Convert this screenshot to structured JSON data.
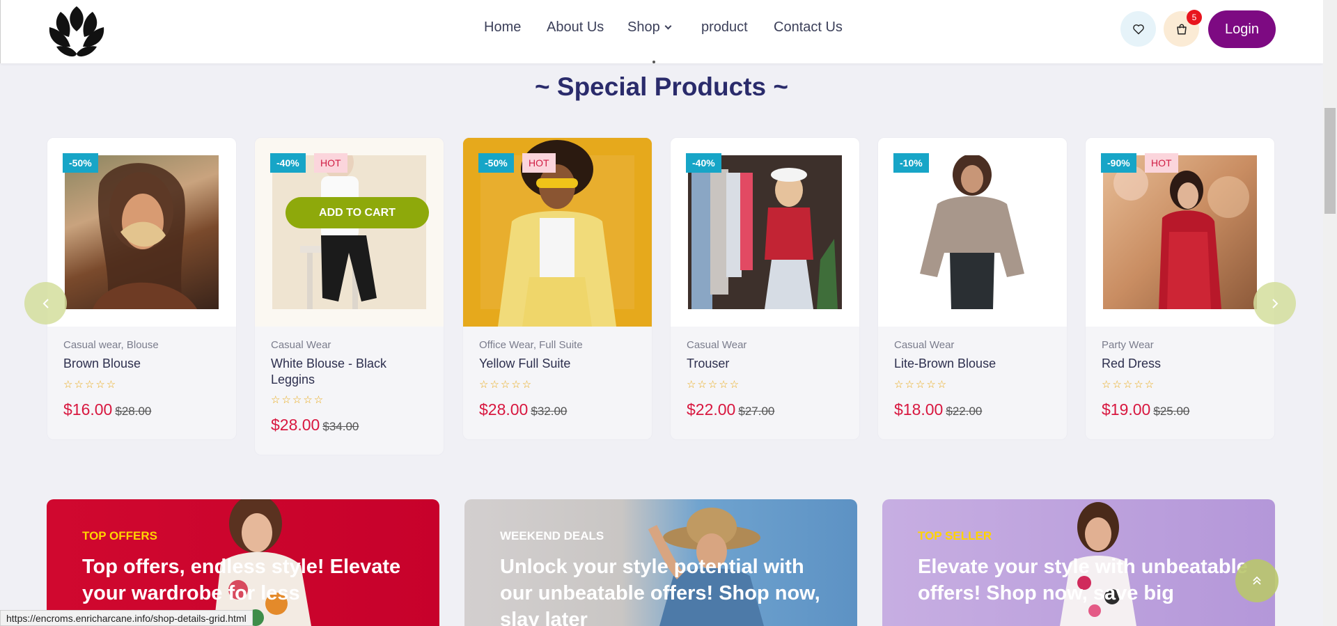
{
  "header": {
    "logo_icon": "leaf-lotus-logo",
    "nav": [
      {
        "label": "Home"
      },
      {
        "label": "About Us"
      },
      {
        "label": "Shop"
      },
      {
        "label": "product"
      },
      {
        "label": "Contact Us"
      }
    ],
    "wishlist_icon": "heart-icon",
    "cart_icon": "shopping-bag-icon",
    "cart_count": "5",
    "login_label": "Login"
  },
  "section": {
    "title": "~ Special Products ~"
  },
  "products": [
    {
      "discount": "-50%",
      "hot": "",
      "category": "Casual wear, Blouse",
      "name": "Brown Blouse",
      "rating": 0,
      "price": "$16.00",
      "old_price": "$28.00"
    },
    {
      "discount": "-40%",
      "hot": "HOT",
      "category": "Casual Wear",
      "name": "White Blouse - Black Leggins",
      "rating": 0,
      "price": "$28.00",
      "old_price": "$34.00",
      "add_to_cart": "ADD TO CART"
    },
    {
      "discount": "-50%",
      "hot": "HOT",
      "category": "Office Wear, Full Suite",
      "name": "Yellow Full Suite",
      "rating": 0,
      "price": "$28.00",
      "old_price": "$32.00"
    },
    {
      "discount": "-40%",
      "hot": "",
      "category": "Casual Wear",
      "name": "Trouser",
      "rating": 0,
      "price": "$22.00",
      "old_price": "$27.00"
    },
    {
      "discount": "-10%",
      "hot": "",
      "category": "Casual Wear",
      "name": "Lite-Brown Blouse",
      "rating": 0,
      "price": "$18.00",
      "old_price": "$22.00"
    },
    {
      "discount": "-90%",
      "hot": "HOT",
      "category": "Party Wear",
      "name": "Red Dress",
      "rating": 0,
      "price": "$19.00",
      "old_price": "$25.00"
    }
  ],
  "stars_text": "☆☆☆☆☆",
  "carousel": {
    "prev_icon": "chevron-left-icon",
    "next_icon": "chevron-right-icon"
  },
  "promos": [
    {
      "tag": "TOP OFFERS",
      "text": "Top offers, endless style! Elevate your wardrobe for less",
      "tag_color": "#ffd400"
    },
    {
      "tag": "WEEKEND DEALS",
      "text": "Unlock your style potential with our unbeatable offers! Shop now, slay later",
      "tag_color": "#ffffff"
    },
    {
      "tag": "TOP SELLER",
      "text": "Elevate your style with unbeatable offers! Shop now, save big",
      "tag_color": "#ffd400"
    }
  ],
  "status_url": "https://encroms.enricharcane.info/shop-details-grid.html",
  "colors": {
    "accent_purple": "#7d0a82",
    "heading_navy": "#2a2b6b",
    "price_red": "#d8173f",
    "badge_teal": "#17a5c7",
    "add_to_cart_green": "#8ea90b"
  }
}
